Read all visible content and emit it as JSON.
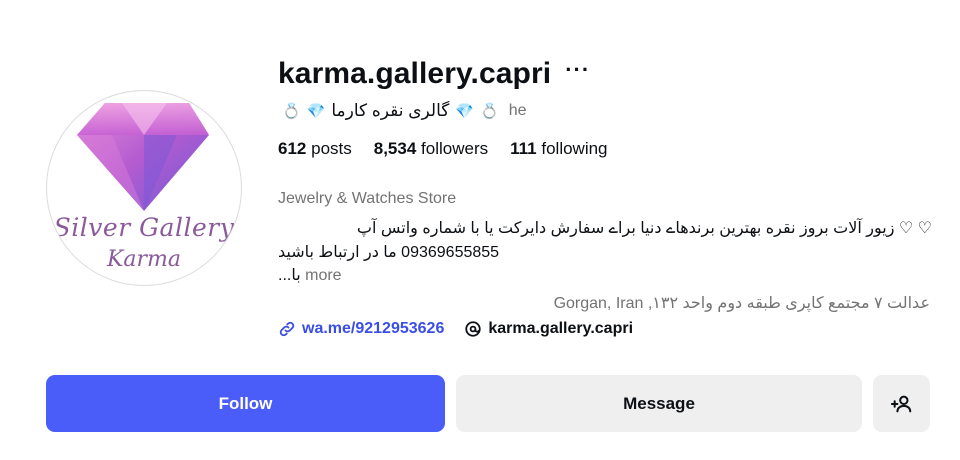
{
  "profile": {
    "avatar_text_line1": "Silver Gallery",
    "avatar_text_line2": "Karma",
    "username": "karma.gallery.capri",
    "more_options": "···",
    "full_name": "گالری نقره کارما",
    "full_name_prefix_icons": [
      "ring-icon",
      "gem-icon"
    ],
    "full_name_suffix_icons": [
      "gem-icon",
      "ring-icon"
    ],
    "pronouns": "he"
  },
  "stats": {
    "posts_count": "612",
    "posts_label": "posts",
    "followers_count": "8,534",
    "followers_label": "followers",
    "following_count": "111",
    "following_label": "following"
  },
  "bio": {
    "category": "Jewelry & Watches Store",
    "line1": "♡ ♡ زیور آلات بروز نقره بهترین برندهاے دنیا براے سفارش دایرکت یا با شماره واتس آپ",
    "line2": "09369655855 ما در ارتباط باشید",
    "line3": "...با",
    "more": "more",
    "address": "عدالت ۷ مجتمع کاپری طبقه دوم واحد ۱۳۲, Gorgan, Iran"
  },
  "links": {
    "whatsapp": "wa.me/9212953626",
    "threads": "karma.gallery.capri"
  },
  "actions": {
    "follow": "Follow",
    "message": "Message"
  },
  "colors": {
    "accent": "#4a5df9",
    "link": "#3a4ee6",
    "secondary_button": "#efefef",
    "muted_text": "#737373",
    "gem": "#c95bc9"
  }
}
